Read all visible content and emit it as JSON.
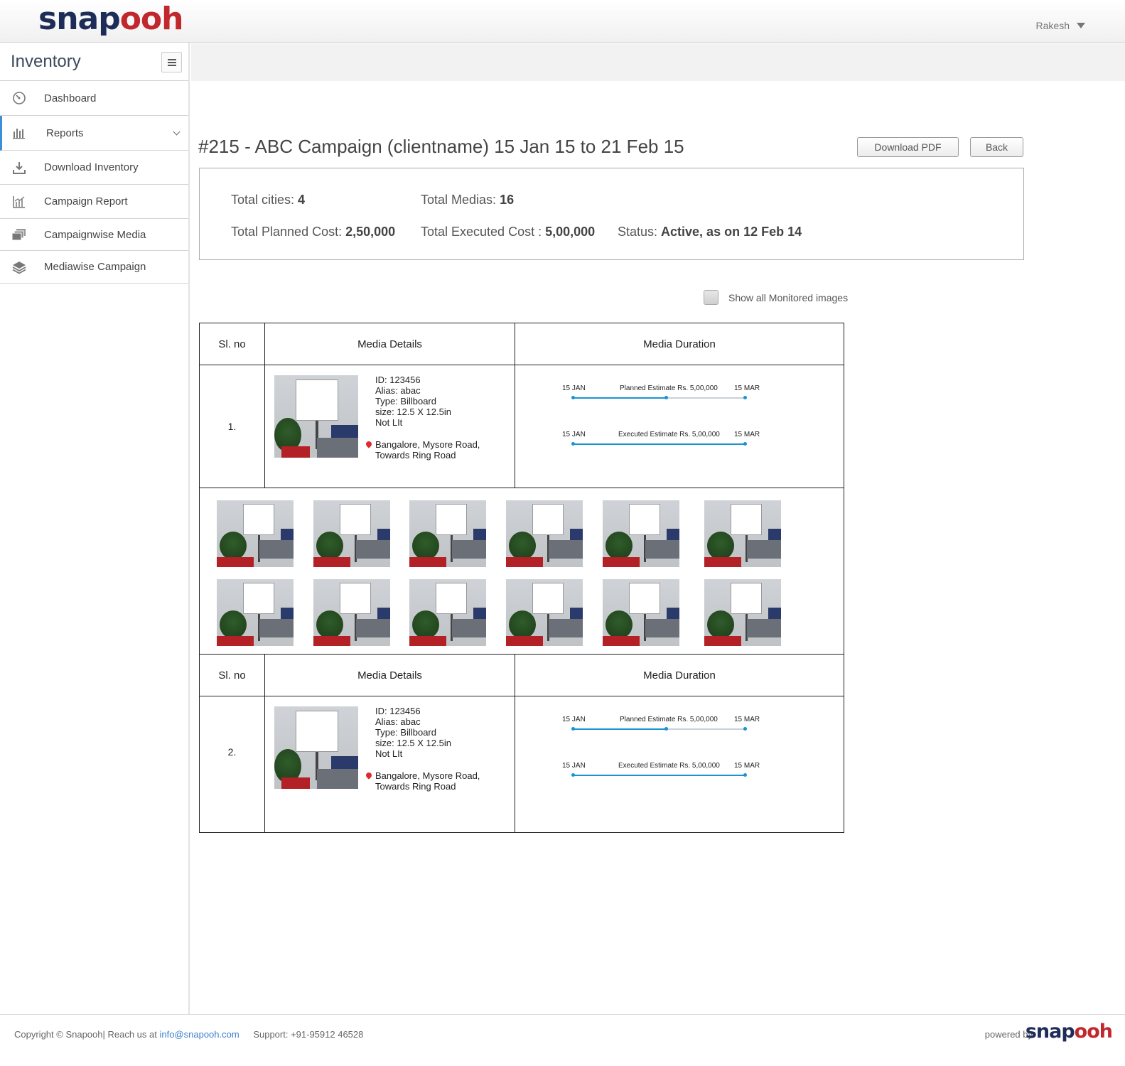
{
  "header": {
    "logo_part1": "snap",
    "logo_part2": "ooh",
    "user_name": "Rakesh"
  },
  "sidebar": {
    "title": "Inventory",
    "items": [
      {
        "label": "Dashboard",
        "icon": "dashboard-icon"
      },
      {
        "label": "Reports",
        "icon": "bar-chart-icon"
      },
      {
        "label": "Download Inventory",
        "icon": "download-icon"
      },
      {
        "label": "Campaign Report",
        "icon": "line-chart-icon"
      },
      {
        "label": "Campaignwise Media",
        "icon": "stacked-pages-icon"
      },
      {
        "label": "Mediawise Campaign",
        "icon": "layers-icon"
      }
    ]
  },
  "page": {
    "title": "#215 - ABC Campaign (clientname)  15 Jan 15 to 21 Feb 15",
    "download_pdf": "Download PDF",
    "back": "Back"
  },
  "summary": {
    "cities_label": "Total cities: ",
    "cities_value": "4",
    "medias_label": "Total Medias: ",
    "medias_value": "16",
    "planned_label": "Total Planned Cost: ",
    "planned_value": "2,50,000",
    "executed_label": "Total Executed Cost : ",
    "executed_value": "5,00,000",
    "status_label": "Status: ",
    "status_value": "Active, as on 12 Feb 14"
  },
  "show_all_label": "Show all Monitored images",
  "table": {
    "headers": [
      "Sl. no",
      "Media Details",
      "Media Duration"
    ],
    "rows": [
      {
        "sl": "1.",
        "id": "ID: 123456",
        "alias": "Alias: abac",
        "type": "Type: Billboard",
        "size": "size: 12.5 X 12.5in",
        "lit": "Not LIt",
        "loc1": "Bangalore, Mysore Road,",
        "loc2": "Towards Ring Road",
        "planned": {
          "start": "15 JAN",
          "label": "Planned Estimate Rs. 5,00,000",
          "end": "15 MAR",
          "progress": 0.54
        },
        "executed": {
          "start": "15 JAN",
          "label": "Executed Estimate Rs. 5,00,000",
          "end": "15 MAR",
          "progress": 1.0
        }
      },
      {
        "sl": "2.",
        "id": "ID: 123456",
        "alias": "Alias: abac",
        "type": "Type: Billboard",
        "size": "size: 12.5 X 12.5in",
        "lit": "Not LIt",
        "loc1": "Bangalore, Mysore Road,",
        "loc2": "Towards Ring Road",
        "planned": {
          "start": "15 JAN",
          "label": "Planned Estimate Rs. 5,00,000",
          "end": "15 MAR",
          "progress": 0.54
        },
        "executed": {
          "start": "15 JAN",
          "label": "Executed Estimate Rs. 5,00,000",
          "end": "15 MAR",
          "progress": 1.0
        }
      }
    ]
  },
  "colors": {
    "accent": "#1a93d1",
    "track": "#c8d2d8",
    "brand_dark": "#1e2d57",
    "brand_red": "#c0282d"
  },
  "footer": {
    "copyright": "Copyright © Snapooh| Reach us at ",
    "email": "info@snapooh.com",
    "support": "Support: +91-95912 46528",
    "powered_by": "powered by",
    "logo_part1": "snap",
    "logo_part2": "ooh"
  }
}
